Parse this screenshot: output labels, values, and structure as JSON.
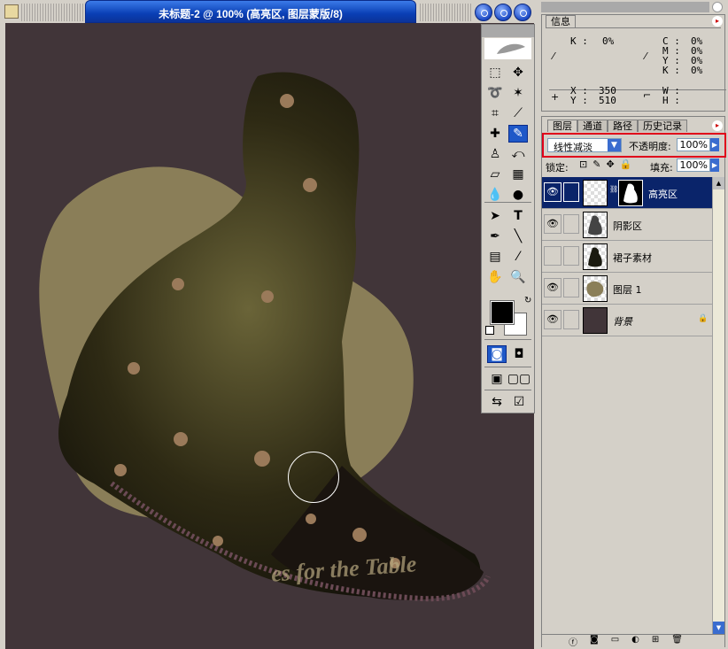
{
  "document": {
    "title": "未标题-2 @ 100% (高亮区, 图层蒙版/8)",
    "watermark_text": "es for the Table"
  },
  "info_panel": {
    "tab": "信息",
    "k_label": "K :",
    "k_value": "0%",
    "cmyk_labels": "C :\nM :\nY :\nK :",
    "cmyk_values": "0%\n0%\n0%\n0%",
    "xy_labels": "X :\nY :",
    "x_value": "350",
    "y_value": "510",
    "wh_labels": "W :\nH :"
  },
  "layers_panel": {
    "tabs": [
      "图层",
      "通道",
      "路径",
      "历史记录"
    ],
    "blend_mode": "线性减淡",
    "opacity_label": "不透明度:",
    "opacity_value": "100%",
    "lock_label": "锁定:",
    "fill_label": "填充:",
    "fill_value": "100%",
    "layers": [
      {
        "name": "高亮区",
        "visible": true,
        "selected": true
      },
      {
        "name": "阴影区",
        "visible": true,
        "selected": false
      },
      {
        "name": "裙子素材",
        "visible": false,
        "selected": false
      },
      {
        "name": "图层 1",
        "visible": true,
        "selected": false
      },
      {
        "name": "背景",
        "visible": true,
        "selected": false
      }
    ]
  },
  "colors": {
    "canvas_background": "#413539",
    "selection_highlight": "#0a246a",
    "annotation_box": "#e0001a",
    "foreground_color": "#000000",
    "background_color": "#ffffff"
  }
}
